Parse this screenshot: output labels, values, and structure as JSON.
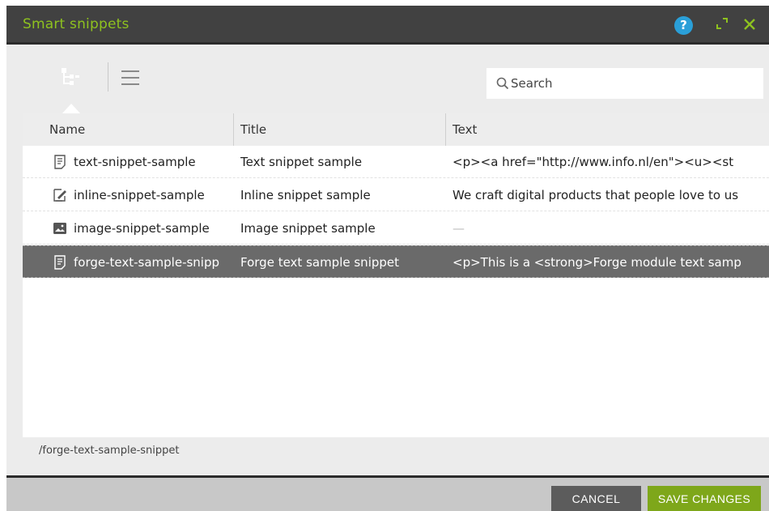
{
  "window": {
    "title": "Smart snippets",
    "help_glyph": "?",
    "icons": [
      "help-icon",
      "maximize-icon",
      "close-icon"
    ],
    "accent_color": "#8ec21f",
    "titlebar_color": "#414141"
  },
  "toolbar": {
    "views": [
      "tree-view-icon",
      "list-view-icon"
    ],
    "active_view": "tree",
    "search": {
      "placeholder": "Search",
      "value": ""
    }
  },
  "table": {
    "columns": [
      "Name",
      "Title",
      "Text"
    ],
    "rows": [
      {
        "icon": "text-document-icon",
        "name": "text-snippet-sample",
        "title": "Text snippet sample",
        "text": "<p><a href=\"http://www.info.nl/en\"><u><st",
        "selected": false
      },
      {
        "icon": "inline-edit-icon",
        "name": "inline-snippet-sample",
        "title": "Inline snippet sample",
        "text": "We craft digital products that people love to us",
        "selected": false
      },
      {
        "icon": "image-icon",
        "name": "image-snippet-sample",
        "title": "Image snippet sample",
        "text": "—",
        "selected": false
      },
      {
        "icon": "text-document-icon",
        "name": "forge-text-sample-snipp",
        "title": "Forge text sample snippet",
        "text": "<p>This is a <strong>Forge module text samp",
        "selected": true
      }
    ]
  },
  "status": {
    "path": "/forge-text-sample-snippet"
  },
  "footer": {
    "cancel_label": "CANCEL",
    "save_label": "SAVE CHANGES",
    "save_color": "#7ea71a"
  }
}
